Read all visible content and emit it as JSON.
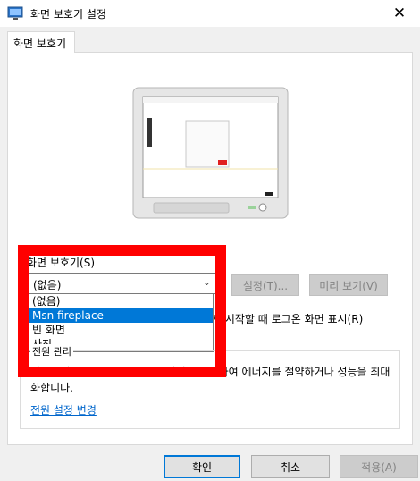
{
  "window": {
    "title": "화면 보호기 설정",
    "close_glyph": "✕"
  },
  "tab": {
    "label": "화면 보호기"
  },
  "screensaver": {
    "group_label": "화면 보호기(S)",
    "selected_value": "(없음)",
    "options": [
      "(없음)",
      "Msn fireplace",
      "빈 화면",
      "사진"
    ],
    "highlighted_option": "Msn fireplace",
    "settings_button": "설정(T)...",
    "preview_button": "미리 보기(V)",
    "resume_text": "시 시작할 때 로그온 화면 표시(R)"
  },
  "power": {
    "legend": "전원 관리",
    "description": "디스플레이 밝기 및 기타 전원 설정을 조정하여 에너지를 절약하거나 성능을 최대화합니다.",
    "link": "전원 설정 변경"
  },
  "footer": {
    "ok": "확인",
    "cancel": "취소",
    "apply": "적용(A)"
  },
  "colors": {
    "accent": "#0078d7",
    "highlight_frame": "#ff0000",
    "link": "#0066cc"
  }
}
